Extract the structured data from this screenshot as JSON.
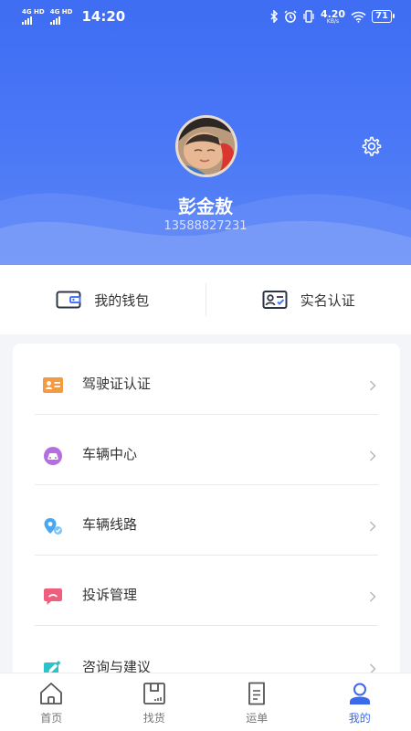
{
  "status_bar": {
    "network_1": "4G HD",
    "network_2": "4G HD",
    "time": "14:20",
    "speed_value": "4.20",
    "speed_unit": "KB/s",
    "battery": "71"
  },
  "profile": {
    "name": "彭金敖",
    "phone": "13588827231"
  },
  "quick_actions": [
    {
      "label": "我的钱包",
      "icon": "wallet-icon"
    },
    {
      "label": "实名认证",
      "icon": "id-card-icon"
    }
  ],
  "menu": [
    {
      "label": "驾驶证认证",
      "icon": "driver-license-icon",
      "color": "#f39a45"
    },
    {
      "label": "车辆中心",
      "icon": "car-icon",
      "color": "#b46ee0"
    },
    {
      "label": "车辆线路",
      "icon": "route-icon",
      "color": "#49a7f2"
    },
    {
      "label": "投诉管理",
      "icon": "complaint-icon",
      "color": "#ef5f7d"
    },
    {
      "label": "咨询与建议",
      "icon": "suggestion-icon",
      "color": "#2cc3c8"
    }
  ],
  "tabs": [
    {
      "label": "首页",
      "icon": "home-icon",
      "active": false
    },
    {
      "label": "找货",
      "icon": "cargo-icon",
      "active": false
    },
    {
      "label": "运单",
      "icon": "waybill-icon",
      "active": false
    },
    {
      "label": "我的",
      "icon": "profile-icon",
      "active": true
    }
  ],
  "colors": {
    "header": "#4a78f6",
    "accent": "#3c68ee",
    "background": "#f4f5f9"
  }
}
